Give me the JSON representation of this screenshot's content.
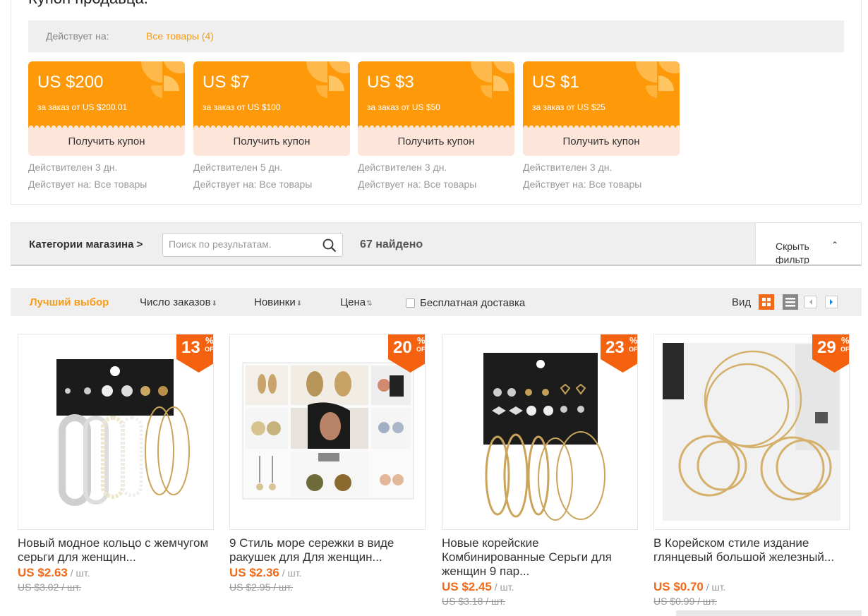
{
  "coupons_section": {
    "title": "Купон продавца.",
    "applies_label": "Действует на:",
    "applies_link": "Все товары (4)",
    "coupons": [
      {
        "amount": "US $200",
        "condition": "за заказ от US $200.01",
        "button": "Получить купон",
        "validity": "Действителен 3 дн.",
        "applies": "Действует на: Все товары"
      },
      {
        "amount": "US $7",
        "condition": "за заказ от US $100",
        "button": "Получить купон",
        "validity": "Действителен 5 дн.",
        "applies": "Действует на: Все товары"
      },
      {
        "amount": "US $3",
        "condition": "за заказ от US $50",
        "button": "Получить купон",
        "validity": "Действителен 3 дн.",
        "applies": "Действует на: Все товары"
      },
      {
        "amount": "US $1",
        "condition": "за заказ от US $25",
        "button": "Получить купон",
        "validity": "Действителен 3 дн.",
        "applies": "Действует на: Все товары"
      }
    ]
  },
  "filter_bar": {
    "categories_label": "Категории магазина >",
    "search_placeholder": "Поиск по результатам.",
    "found": "67 найдено",
    "hide_filter": "Скрыть фильтр"
  },
  "sort_bar": {
    "best": "Лучший выбор",
    "orders": "Число заказов",
    "new": "Новинки",
    "price": "Цена",
    "free_shipping": "Бесплатная доставка",
    "view_label": "Вид"
  },
  "products": [
    {
      "discount": "13",
      "title": "Новый модное кольцо с жемчугом серьги для женщин...",
      "price": "US $2.63",
      "unit": " / шт.",
      "old_price": "US $3.02 / шт."
    },
    {
      "discount": "20",
      "title": "9 Стиль море сережки в виде ракушек для Для женщин...",
      "price": "US $2.36",
      "unit": " / шт.",
      "old_price": "US $2.95 / шт."
    },
    {
      "discount": "23",
      "title": "Новые корейские Комбинированные Серьги для женщин 9 пар...",
      "price": "US $2.45",
      "unit": " / шт.",
      "old_price": "US $3.18 / шт."
    },
    {
      "discount": "29",
      "title": "В Корейском стиле издание глянцевый большой железный...",
      "price": "US $0.70",
      "unit": " / шт.",
      "old_price": "US $0.99 / шт."
    }
  ],
  "badge": {
    "percent": "%",
    "off": "OFF"
  },
  "colors": {
    "accent": "#fe9a09",
    "price": "#f06a1a",
    "coupon_bottom": "#fde6d9"
  }
}
